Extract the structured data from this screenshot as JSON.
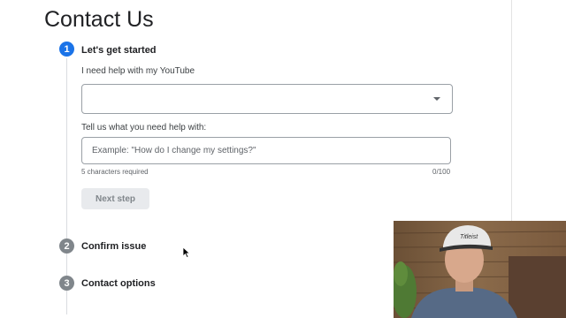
{
  "page": {
    "title": "Contact Us"
  },
  "steps": [
    {
      "number": "1",
      "label": "Let's get started",
      "state": "active"
    },
    {
      "number": "2",
      "label": "Confirm issue",
      "state": "inactive"
    },
    {
      "number": "3",
      "label": "Contact options",
      "state": "inactive"
    }
  ],
  "form": {
    "product_label": "I need help with my YouTube",
    "product_value": "",
    "issue_label": "Tell us what you need help with:",
    "issue_placeholder": "Example: \"How do I change my settings?\"",
    "issue_value": "",
    "requirement_text": "5 characters required",
    "char_counter": "0/100",
    "next_label": "Next step"
  },
  "colors": {
    "accent": "#1a73e8",
    "inactive_step": "#80868b",
    "button_disabled_bg": "#e8eaed"
  }
}
